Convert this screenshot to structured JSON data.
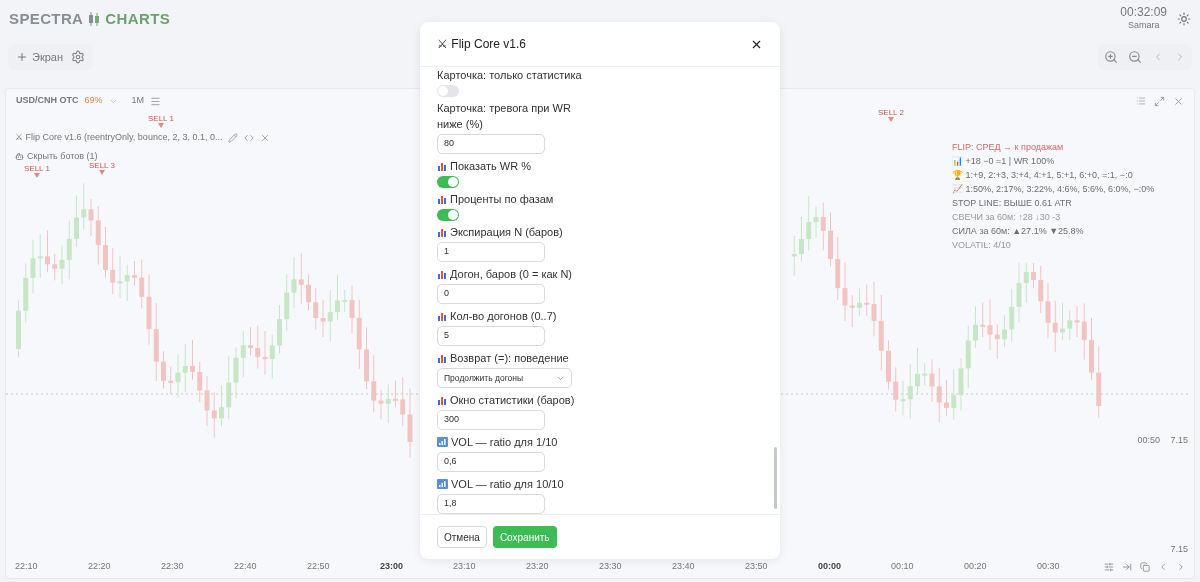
{
  "header": {
    "logo_left": "SPECTRA",
    "logo_right": "CHARTS",
    "time": "00:32:09",
    "city": "Samara"
  },
  "toolbar": {
    "add_screen": "Экран"
  },
  "chart_panel": {
    "symbol": "USD/CNH OTC",
    "payout": "69%",
    "timeframe": "1M",
    "bot_line": "⚔ Flip Core v1.6 (reentryOnly, bounce, 2, 3, 0.1, 0...",
    "hide_bots": "Скрыть ботов (1)",
    "signals": [
      "SELL 1",
      "SELL 3",
      "SELL 1",
      "SELL 2"
    ],
    "card_lines": [
      {
        "kind": "signal",
        "text": "FLIP: СРЕД → к продажам"
      },
      {
        "kind": "stat",
        "text": "📊 +18 −0 =1 | WR 100%"
      },
      {
        "kind": "stat",
        "text": "🏆 1:+9, 2:+3, 3:+4, 4:+1, 5:+1, 6:+0, =:1, −:0"
      },
      {
        "kind": "stat",
        "text": "📈 1:50%, 2:17%, 3:22%, 4:6%, 5:6%, 6:0%, −:0%"
      },
      {
        "kind": "stat",
        "text": "STOP LINE: ВЫШЕ 0.61 ATR"
      },
      {
        "kind": "muted",
        "text": "СВЕЧИ за 60м: ↑28 ↓30 -3"
      },
      {
        "kind": "stat",
        "text": "СИЛА за 60м: ▲27.1% ▼25.8%"
      },
      {
        "kind": "muted",
        "text": "VOLATIL: 4/10"
      }
    ],
    "price_labels": [
      "00:50",
      "7.15",
      "7.15"
    ],
    "x_ticks": [
      {
        "label": "22:10",
        "emphasized": false
      },
      {
        "label": "22:20",
        "emphasized": false
      },
      {
        "label": "22:30",
        "emphasized": false
      },
      {
        "label": "22:40",
        "emphasized": false
      },
      {
        "label": "22:50",
        "emphasized": false
      },
      {
        "label": "23:00",
        "emphasized": true
      },
      {
        "label": "23:10",
        "emphasized": false
      },
      {
        "label": "23:20",
        "emphasized": false
      },
      {
        "label": "23:30",
        "emphasized": false
      },
      {
        "label": "23:40",
        "emphasized": false
      },
      {
        "label": "23:50",
        "emphasized": false
      },
      {
        "label": "00:00",
        "emphasized": true
      },
      {
        "label": "00:10",
        "emphasized": false
      },
      {
        "label": "00:20",
        "emphasized": false
      },
      {
        "label": "00:30",
        "emphasized": false
      }
    ]
  },
  "dialog": {
    "title": "⚔ Flip Core v1.6",
    "fields": [
      {
        "kind": "toggle",
        "label": "Карточка: только статистика",
        "on": false
      },
      {
        "kind": "input",
        "label": "Карточка: тревога при WR ниже (%)",
        "value": "80"
      },
      {
        "kind": "toggle",
        "label": "Показать WR %",
        "on": true
      },
      {
        "kind": "toggle",
        "label": "Проценты по фазам",
        "on": true
      },
      {
        "kind": "input",
        "label": "Экспирация N (баров)",
        "value": "1"
      },
      {
        "kind": "input",
        "label": "Догон, баров (0 = как N)",
        "value": "0"
      },
      {
        "kind": "input",
        "label": "Кол-во догонов (0..7)",
        "value": "5"
      },
      {
        "kind": "select",
        "label": "Возврат (=): поведение",
        "value": "Продолжить догоны"
      },
      {
        "kind": "input",
        "label": "Окно статистики (баров)",
        "value": "300"
      },
      {
        "kind": "input",
        "label": "VOL — ratio для 1/10",
        "value": "0,6"
      },
      {
        "kind": "input",
        "label": "VOL — ratio для 10/10",
        "value": "1,8"
      }
    ],
    "buttons": {
      "cancel": "Отмена",
      "save": "Сохранить"
    }
  }
}
